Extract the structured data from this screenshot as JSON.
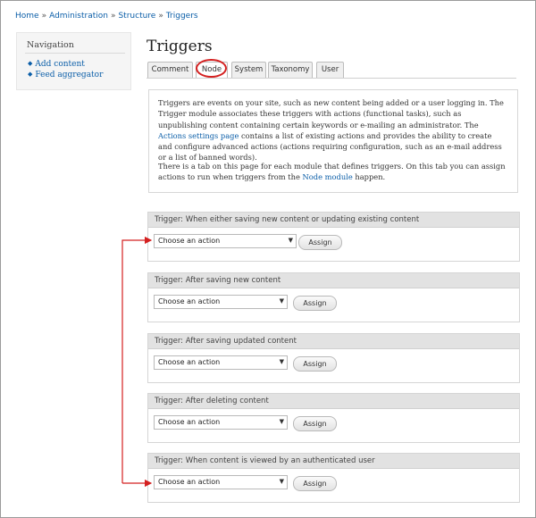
{
  "breadcrumb": [
    "Home",
    "Administration",
    "Structure",
    "Triggers"
  ],
  "breadcrumb_sep": "»",
  "sidebar": {
    "title": "Navigation",
    "items": [
      {
        "label": "Add content"
      },
      {
        "label": "Feed aggregator"
      }
    ]
  },
  "page_title": "Triggers",
  "tabs": [
    {
      "label": "Comment"
    },
    {
      "label": "Node"
    },
    {
      "label": "System"
    },
    {
      "label": "Taxonomy"
    },
    {
      "label": "User"
    }
  ],
  "info": {
    "p1_a": "Triggers are events on your site, such as new content being added or a user logging in. The Trigger module associates these triggers with actions (functional tasks), such as unpublishing content containing certain keywords or e-mailing an administrator. The ",
    "p1_link": "Actions settings page",
    "p1_b": " contains a list of existing actions and provides the ability to create and configure advanced actions (actions requiring configuration, such as an e-mail address or a list of banned words).",
    "p2_a": "There is a tab on this page for each module that defines triggers. On this tab you can assign actions to run when triggers from the ",
    "p2_link": "Node module",
    "p2_b": " happen."
  },
  "triggers": [
    {
      "title": "Trigger: When either saving new content or updating existing content",
      "select": "Choose an action",
      "button": "Assign"
    },
    {
      "title": "Trigger: After saving new content",
      "select": "Choose an action",
      "button": "Assign"
    },
    {
      "title": "Trigger: After saving updated content",
      "select": "Choose an action",
      "button": "Assign"
    },
    {
      "title": "Trigger: After deleting content",
      "select": "Choose an action",
      "button": "Assign"
    },
    {
      "title": "Trigger: When content is viewed by an authenticated user",
      "select": "Choose an action",
      "button": "Assign"
    }
  ],
  "icons": {
    "dropdown_arrow": "▼",
    "bullet": "◆"
  },
  "colors": {
    "link": "#0b5ea8",
    "annotation": "#d42020",
    "header_bg": "#e2e2e2"
  }
}
